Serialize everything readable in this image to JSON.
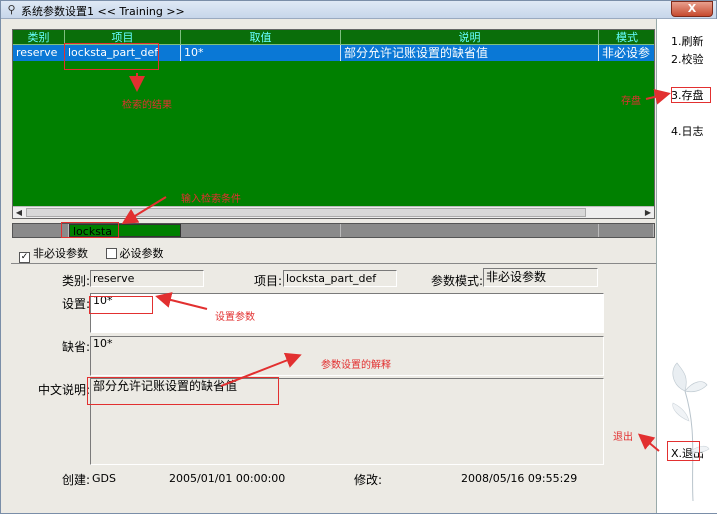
{
  "window": {
    "title": "系统参数设置1 << Training >>",
    "close_label": "X"
  },
  "grid": {
    "headers": [
      "类别",
      "项目",
      "取值",
      "说明",
      "模式"
    ],
    "rows": [
      {
        "category": "reserve",
        "item": "locksta_part_def",
        "value": "10*",
        "description": "部分允许记账设置的缺省值",
        "mode": "非必设参"
      }
    ],
    "filter_value": "locksta"
  },
  "checkboxes": [
    {
      "label": "非必设参数",
      "checked": true
    },
    {
      "label": "必设参数",
      "checked": false
    }
  ],
  "detail": {
    "category_label": "类别:",
    "category_value": "reserve",
    "item_label": "项目:",
    "item_value": "locksta_part_def",
    "mode_label": "参数模式:",
    "mode_value": "非必设参数",
    "setting_label": "设置:",
    "setting_value": "10*",
    "default_label": "缺省:",
    "default_value": "10*",
    "description_label": "中文说明:",
    "description_value": "部分允许记账设置的缺省值",
    "created_label": "创建:",
    "created_by": "GDS",
    "created_time": "2005/01/01 00:00:00",
    "modified_label": "修改:",
    "modified_time": "2008/05/16 09:55:29"
  },
  "menu": {
    "refresh": "1.刷新",
    "validate": "2.校验",
    "save": "3.存盘",
    "log": "4.日志",
    "exit": "X.退出"
  },
  "annotations": {
    "search_result": "检索的结果",
    "input_search": "输入检索条件",
    "save": "存盘",
    "set_param": "设置参数",
    "param_explain": "参数设置的解释",
    "exit": "退出"
  },
  "colors": {
    "grid_bg": "#008000",
    "selected_row": "#0a78d6",
    "header_text": "#66ffff",
    "annotation": "#e23030"
  }
}
